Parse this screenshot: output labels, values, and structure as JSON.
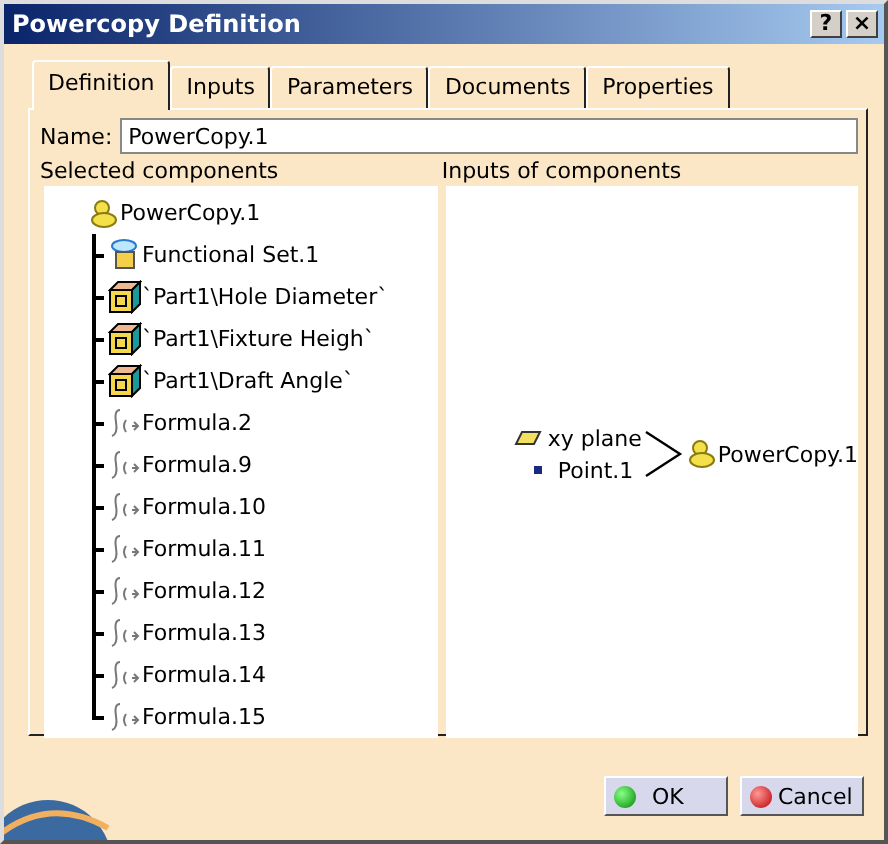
{
  "window": {
    "title": "Powercopy Definition",
    "controls": [
      "?",
      "×"
    ]
  },
  "tabs": [
    {
      "label": "Definition",
      "selected": true
    },
    {
      "label": "Inputs",
      "selected": false
    },
    {
      "label": "Parameters",
      "selected": false
    },
    {
      "label": "Documents",
      "selected": false
    },
    {
      "label": "Properties",
      "selected": false
    }
  ],
  "name_field": {
    "label": "Name:",
    "value": "PowerCopy.1"
  },
  "selected_components": {
    "title": "Selected components",
    "tree": [
      {
        "label": "PowerCopy.1",
        "kind": "powercopy",
        "children": [
          {
            "label": "Functional Set.1",
            "kind": "set"
          },
          {
            "label": "`Part1\\Hole Diameter`",
            "kind": "parameter"
          },
          {
            "label": "`Part1\\Fixture Heigh`",
            "kind": "parameter"
          },
          {
            "label": "`Part1\\Draft Angle`",
            "kind": "parameter"
          },
          {
            "label": "Formula.2",
            "kind": "formula"
          },
          {
            "label": "Formula.9",
            "kind": "formula"
          },
          {
            "label": "Formula.10",
            "kind": "formula"
          },
          {
            "label": "Formula.11",
            "kind": "formula"
          },
          {
            "label": "Formula.12",
            "kind": "formula"
          },
          {
            "label": "Formula.13",
            "kind": "formula"
          },
          {
            "label": "Formula.14",
            "kind": "formula"
          },
          {
            "label": "Formula.15",
            "kind": "formula"
          }
        ]
      }
    ]
  },
  "inputs_of_components": {
    "title": "Inputs of components",
    "inputs": [
      {
        "label": "xy plane",
        "kind": "plane"
      },
      {
        "label": "Point.1",
        "kind": "point"
      }
    ],
    "output": {
      "label": "PowerCopy.1",
      "kind": "powercopy"
    }
  },
  "buttons": [
    {
      "label": "OK",
      "kind": "ok"
    },
    {
      "label": "Cancel",
      "kind": "cancel"
    }
  ]
}
